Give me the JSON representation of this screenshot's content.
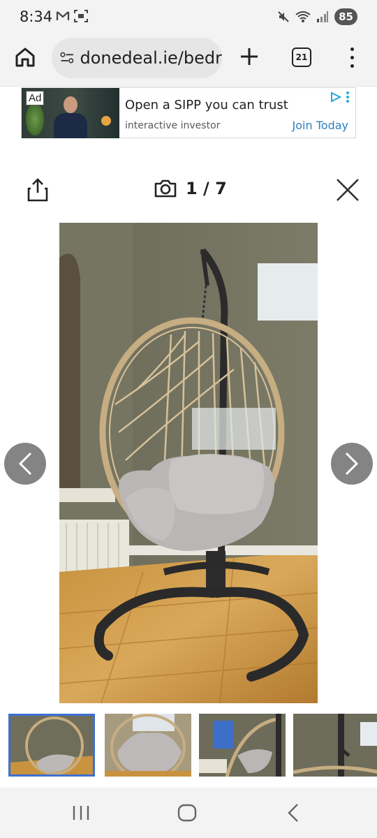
{
  "status_bar": {
    "time": "8:34",
    "battery": "85",
    "left_icons": [
      "gmail-icon",
      "screenshot-icon"
    ],
    "right_icons": [
      "mute-icon",
      "wifi-icon",
      "signal-icon"
    ]
  },
  "browser": {
    "url": "donedeal.ie/bedr",
    "tab_count": "21"
  },
  "ad": {
    "badge": "Ad",
    "title": "Open a SIPP you can trust",
    "advertiser": "interactive investor",
    "cta": "Join Today"
  },
  "viewer": {
    "counter": "1 / 7",
    "current_index": 1,
    "total": 7
  },
  "colors": {
    "accent": "#3d6fd4",
    "ad_link": "#2f7fbf",
    "arrow_bg": "#6e6e6e"
  },
  "thumbnails": [
    {
      "name": "thumbnail-1",
      "active": true
    },
    {
      "name": "thumbnail-2",
      "active": false
    },
    {
      "name": "thumbnail-3",
      "active": false
    },
    {
      "name": "thumbnail-4",
      "active": false
    }
  ]
}
